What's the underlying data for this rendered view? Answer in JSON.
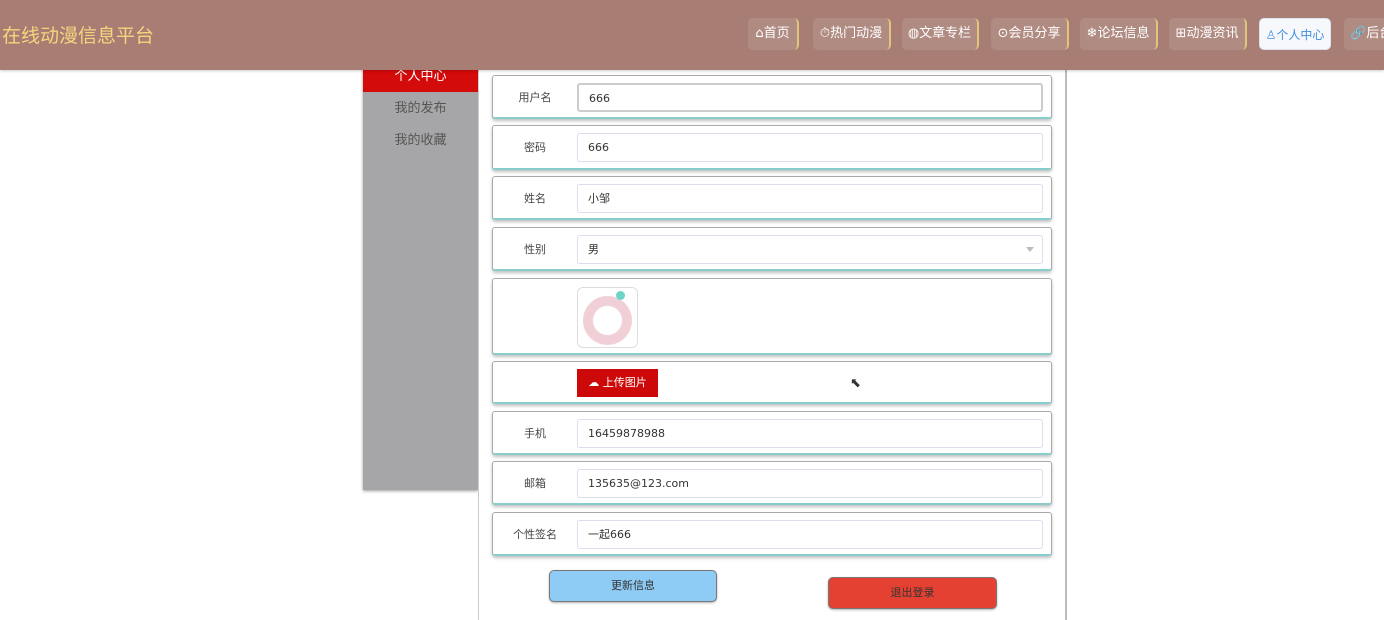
{
  "header": {
    "title": "在线动漫信息平台",
    "nav": [
      {
        "icon": "⌂",
        "label": "首页"
      },
      {
        "icon": "⏱",
        "label": "热门动漫"
      },
      {
        "icon": "◍",
        "label": "文章专栏"
      },
      {
        "icon": "⊙",
        "label": "会员分享"
      },
      {
        "icon": "❄",
        "label": "论坛信息"
      },
      {
        "icon": "⊞",
        "label": "动漫资讯"
      },
      {
        "icon": "♙",
        "label": "个人中心"
      },
      {
        "icon": "🔗",
        "label": "后台"
      }
    ]
  },
  "sidebar": {
    "items": [
      {
        "label": "个人中心"
      },
      {
        "label": "我的发布"
      },
      {
        "label": "我的收藏"
      }
    ]
  },
  "form": {
    "username": {
      "label": "用户名",
      "value": "666"
    },
    "password": {
      "label": "密码",
      "value": "666"
    },
    "name": {
      "label": "姓名",
      "value": "小邹"
    },
    "gender": {
      "label": "性别",
      "value": "男"
    },
    "upload_label": "上传图片",
    "phone": {
      "label": "手机",
      "value": "16459878988"
    },
    "email": {
      "label": "邮箱",
      "value": "135635@123.com"
    },
    "signature": {
      "label": "个性签名",
      "value": "一起666"
    },
    "update_label": "更新信息",
    "logout_label": "退出登录"
  },
  "colors": {
    "header": "#a87e74",
    "title": "#f4d57e",
    "active_side": "#d40b0b",
    "update": "#8ecbf5",
    "logout": "#e54132"
  }
}
